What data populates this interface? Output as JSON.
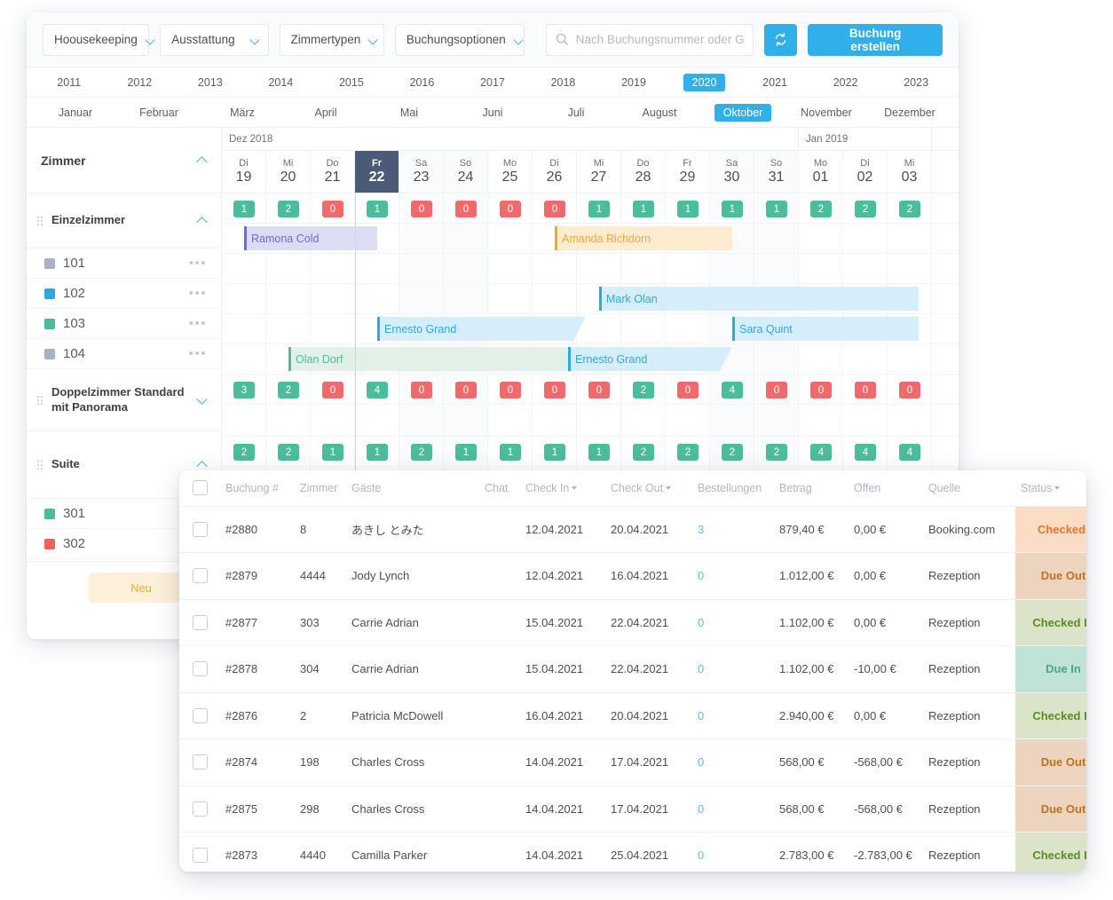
{
  "toolbar": {
    "filters": [
      {
        "label": "Hoousekeeping",
        "icon": "chevron-down-icon"
      },
      {
        "label": "Ausstattung",
        "icon": "chevron-down-icon"
      },
      {
        "label": "Zimmertypen",
        "icon": "chevron-down-icon"
      },
      {
        "label": "Buchungsoptionen",
        "icon": "chevron-down-icon"
      }
    ],
    "search_placeholder": "Nach Buchungsnummer oder Gast...",
    "search_value": "",
    "search_icon": "search-icon",
    "refresh_icon": "refresh-icon",
    "create_button": "Buchung erstellen",
    "accent_color": "#30b0ea"
  },
  "years": {
    "items": [
      "2011",
      "2012",
      "2013",
      "2014",
      "2015",
      "2016",
      "2017",
      "2018",
      "2019",
      "2020",
      "2021",
      "2022",
      "2023"
    ],
    "selected": "2020"
  },
  "months": {
    "items": [
      "Januar",
      "Februar",
      "März",
      "April",
      "Mai",
      "Juni",
      "Juli",
      "August",
      "Oktober",
      "November",
      "Dezember"
    ],
    "selected": "Oktober"
  },
  "month_bands": [
    {
      "label": "Dez 2018",
      "span": 13
    },
    {
      "label": "Jan 2019",
      "span": 3
    }
  ],
  "days": [
    {
      "dow": "Di",
      "num": "19",
      "weekend": false,
      "selected": false
    },
    {
      "dow": "Mi",
      "num": "20",
      "weekend": false,
      "selected": false
    },
    {
      "dow": "Do",
      "num": "21",
      "weekend": false,
      "selected": false
    },
    {
      "dow": "Fr",
      "num": "22",
      "weekend": false,
      "selected": true
    },
    {
      "dow": "Sa",
      "num": "23",
      "weekend": true,
      "selected": false
    },
    {
      "dow": "So",
      "num": "24",
      "weekend": true,
      "selected": false
    },
    {
      "dow": "Mo",
      "num": "25",
      "weekend": false,
      "selected": false
    },
    {
      "dow": "Di",
      "num": "26",
      "weekend": false,
      "selected": false
    },
    {
      "dow": "Mi",
      "num": "27",
      "weekend": false,
      "selected": false
    },
    {
      "dow": "Do",
      "num": "28",
      "weekend": false,
      "selected": false
    },
    {
      "dow": "Fr",
      "num": "29",
      "weekend": false,
      "selected": false
    },
    {
      "dow": "Sa",
      "num": "30",
      "weekend": true,
      "selected": false
    },
    {
      "dow": "So",
      "num": "31",
      "weekend": true,
      "selected": false
    },
    {
      "dow": "Mo",
      "num": "01",
      "weekend": false,
      "selected": false
    },
    {
      "dow": "Di",
      "num": "02",
      "weekend": false,
      "selected": false
    },
    {
      "dow": "Mi",
      "num": "03",
      "weekend": false,
      "selected": false
    }
  ],
  "sidebar": {
    "title": "Zimmer",
    "groups": [
      {
        "label": "Einzelzimmer",
        "expanded": true
      },
      {
        "label": "Doppelzimmer Standard mit Panorama",
        "expanded": false
      },
      {
        "label": "Suite",
        "expanded": true
      }
    ],
    "rooms_einzel": [
      {
        "num": "101",
        "color": "#a7b0c4"
      },
      {
        "num": "102",
        "color": "#2fa8e0"
      },
      {
        "num": "103",
        "color": "#4cbd9c"
      },
      {
        "num": "104",
        "color": "#a7b0c4"
      }
    ],
    "rooms_suite": [
      {
        "num": "301",
        "color": "#4cbd9c"
      },
      {
        "num": "302",
        "color": "#ef5f5f"
      }
    ],
    "new_button": "Neu",
    "more_icon": "more-horizontal-icon"
  },
  "availability": {
    "einzelzimmer": [
      "1",
      "2",
      "0",
      "1",
      "0",
      "0",
      "0",
      "0",
      "1",
      "1",
      "1",
      "1",
      "1",
      "2",
      "2",
      "2"
    ],
    "doppelzimmer": [
      "3",
      "2",
      "0",
      "4",
      "0",
      "0",
      "0",
      "0",
      "0",
      "2",
      "0",
      "4",
      "0",
      "0",
      "0",
      "0"
    ],
    "suite": [
      "2",
      "2",
      "1",
      "1",
      "2",
      "1",
      "1",
      "1",
      "1",
      "2",
      "2",
      "2",
      "2",
      "4",
      "4",
      "4"
    ]
  },
  "bookings": [
    {
      "guest": "Ramona Cold",
      "row": 0,
      "start": 0.5,
      "end": 3.5,
      "fill": "#dcdcf5",
      "text": "#6b6be0",
      "hand": "#6b6be0",
      "slant": false
    },
    {
      "guest": "Amanda Richdorn",
      "row": 0,
      "start": 7.5,
      "end": 11.5,
      "fill": "#fdecd0",
      "text": "#f0a93b",
      "hand": "#f5a623",
      "slant": false
    },
    {
      "guest": "Mark Olan",
      "row": 2,
      "start": 8.5,
      "end": 15.7,
      "fill": "#d6eefa",
      "text": "#2fa8e0",
      "hand": "#2fa8e0",
      "slant": false
    },
    {
      "guest": "Ernesto Grand",
      "row": 3,
      "start": 3.5,
      "end": 8.2,
      "fill": "#d6eefa",
      "text": "#2fa8e0",
      "hand": "#2fa8e0",
      "slant": true
    },
    {
      "guest": "Sara Quint",
      "row": 3,
      "start": 11.5,
      "end": 15.7,
      "fill": "#d6eefa",
      "text": "#2fa8e0",
      "hand": "#2fa8e0",
      "slant": false
    },
    {
      "guest": "Olan Dorf",
      "row": 4,
      "start": 1.5,
      "end": 8.2,
      "fill": "#e2f0e8",
      "text": "#4cbd9c",
      "hand": "#4cbd9c",
      "slant": true
    },
    {
      "guest": "Ernesto Grand",
      "row": 4,
      "start": 7.8,
      "end": 11.5,
      "fill": "#d6eefa",
      "text": "#2fa8e0",
      "hand": "#2fa8e0",
      "slant": true
    }
  ],
  "table": {
    "columns": [
      {
        "label": "",
        "sort": false
      },
      {
        "label": "Buchung #",
        "sort": false
      },
      {
        "label": "Zimmer",
        "sort": false
      },
      {
        "label": "Gäste",
        "sort": false
      },
      {
        "label": "Chat",
        "sort": false
      },
      {
        "label": "Check In",
        "sort": true
      },
      {
        "label": "Check Out",
        "sort": true
      },
      {
        "label": "Bestellungen",
        "sort": false
      },
      {
        "label": "Betrag",
        "sort": false
      },
      {
        "label": "Offen",
        "sort": false
      },
      {
        "label": "Quelle",
        "sort": false
      },
      {
        "label": "Status",
        "sort": true
      }
    ],
    "rows": [
      {
        "booking": "#2880",
        "room": "8",
        "guest": "あきし とみた",
        "checkin": "12.04.2021",
        "checkout": "20.04.2021",
        "orders": "3",
        "amount": "879,40 €",
        "open": "0,00 €",
        "source": "Booking.com",
        "status": "Checked Out",
        "status_bg": "#fbdcc4",
        "status_fg": "#e8762a",
        "has_chevron": false
      },
      {
        "booking": "#2879",
        "room": "4444",
        "guest": "Jody Lynch",
        "checkin": "12.04.2021",
        "checkout": "16.04.2021",
        "orders": "0",
        "amount": "1.012,00 €",
        "open": "0,00 €",
        "source": "Rezeption",
        "status": "Due Out",
        "status_bg": "#ecd5bf",
        "status_fg": "#c4701a",
        "has_chevron": true
      },
      {
        "booking": "#2877",
        "room": "303",
        "guest": "Carrie Adrian",
        "checkin": "15.04.2021",
        "checkout": "22.04.2021",
        "orders": "0",
        "amount": "1.102,00 €",
        "open": "0,00 €",
        "source": "Rezeption",
        "status": "Checked In",
        "status_bg": "#dbe4c8",
        "status_fg": "#5b8c21",
        "has_chevron": true
      },
      {
        "booking": "#2878",
        "room": "304",
        "guest": "Carrie Adrian",
        "checkin": "15.04.2021",
        "checkout": "22.04.2021",
        "orders": "0",
        "amount": "1.102,00 €",
        "open": "-10,00 €",
        "source": "Rezeption",
        "status": "Due In",
        "status_bg": "#bfe3d6",
        "status_fg": "#46a98c",
        "has_chevron": true
      },
      {
        "booking": "#2876",
        "room": "2",
        "guest": "Patricia McDowell",
        "checkin": "16.04.2021",
        "checkout": "20.04.2021",
        "orders": "0",
        "amount": "2.940,00 €",
        "open": "0,00 €",
        "source": "Rezeption",
        "status": "Checked In",
        "status_bg": "#dbe4c8",
        "status_fg": "#5b8c21",
        "has_chevron": true
      },
      {
        "booking": "#2874",
        "room": "198",
        "guest": "Charles Cross",
        "checkin": "14.04.2021",
        "checkout": "17.04.2021",
        "orders": "0",
        "amount": "568,00 €",
        "open": "-568,00 €",
        "source": "Rezeption",
        "status": "Due Out",
        "status_bg": "#ecd5bf",
        "status_fg": "#c4701a",
        "has_chevron": true
      },
      {
        "booking": "#2875",
        "room": "298",
        "guest": "Charles Cross",
        "checkin": "14.04.2021",
        "checkout": "17.04.2021",
        "orders": "0",
        "amount": "568,00 €",
        "open": "-568,00 €",
        "source": "Rezeption",
        "status": "Due Out",
        "status_bg": "#ecd5bf",
        "status_fg": "#c4701a",
        "has_chevron": true
      },
      {
        "booking": "#2873",
        "room": "4440",
        "guest": "Camilla Parker",
        "checkin": "14.04.2021",
        "checkout": "25.04.2021",
        "orders": "0",
        "amount": "2.783,00 €",
        "open": "-2.783,00 €",
        "source": "Rezeption",
        "status": "Checked In",
        "status_bg": "#dbe4c8",
        "status_fg": "#5b8c21",
        "has_chevron": true
      }
    ]
  }
}
